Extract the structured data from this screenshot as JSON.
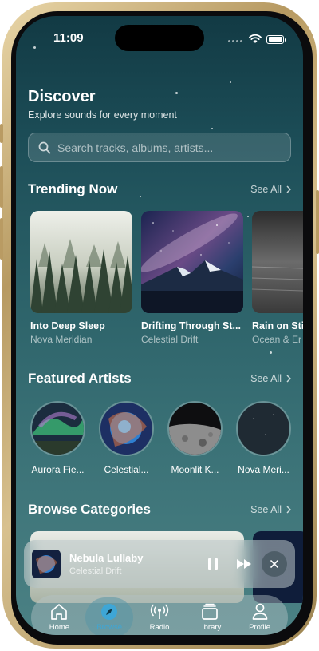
{
  "status_bar": {
    "time": "11:09"
  },
  "header": {
    "title": "Discover",
    "subtitle": "Explore sounds for every moment"
  },
  "search": {
    "placeholder": "Search tracks, albums, artists..."
  },
  "trending": {
    "title": "Trending Now",
    "see_all": "See All",
    "items": [
      {
        "title": "Into Deep Sleep",
        "artist": "Nova Meridian"
      },
      {
        "title": "Drifting Through St...",
        "artist": "Celestial Drift"
      },
      {
        "title": "Rain on Sti",
        "artist": "Ocean & Er"
      }
    ]
  },
  "featured_artists": {
    "title": "Featured Artists",
    "see_all": "See All",
    "items": [
      {
        "name": "Aurora Fie..."
      },
      {
        "name": "Celestial..."
      },
      {
        "name": "Moonlit K..."
      },
      {
        "name": "Nova Meri..."
      }
    ]
  },
  "categories": {
    "title": "Browse Categories",
    "see_all": "See All"
  },
  "now_playing": {
    "title": "Nebula Lullaby",
    "artist": "Celestial Drift"
  },
  "tab_bar": {
    "tabs": [
      {
        "label": "Home",
        "icon": "house-icon"
      },
      {
        "label": "Browse",
        "icon": "compass-icon",
        "active": true
      },
      {
        "label": "Radio",
        "icon": "antenna-icon"
      },
      {
        "label": "Library",
        "icon": "library-icon"
      },
      {
        "label": "Profile",
        "icon": "person-icon"
      }
    ]
  },
  "colors": {
    "accent": "#3ea6d6",
    "background_top": "#123a44",
    "background_bottom": "#4b8184"
  }
}
